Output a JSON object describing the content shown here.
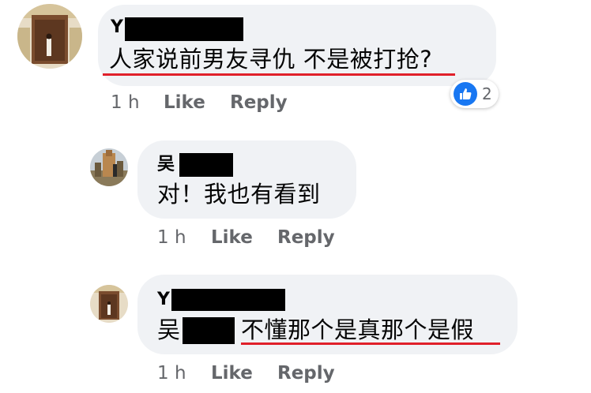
{
  "comments": [
    {
      "name_initial": "Y",
      "text": "人家说前男友寻仇 不是被打抢?",
      "time": "1 h",
      "like_label": "Like",
      "reply_label": "Reply",
      "reaction": {
        "icon": "thumbs-up-icon",
        "count": "2"
      }
    },
    {
      "name_initial": "吴",
      "text": "对！我也有看到",
      "time": "1 h",
      "like_label": "Like",
      "reply_label": "Reply"
    },
    {
      "name_initial": "Y",
      "mention_initial": "吴",
      "text": "不懂那个是真那个是假",
      "time": "1 h",
      "like_label": "Like",
      "reply_label": "Reply"
    }
  ],
  "colors": {
    "bubble": "#f0f2f5",
    "meta_text": "#65676b",
    "underline": "#e0202a",
    "like_blue": "#1877f2"
  }
}
